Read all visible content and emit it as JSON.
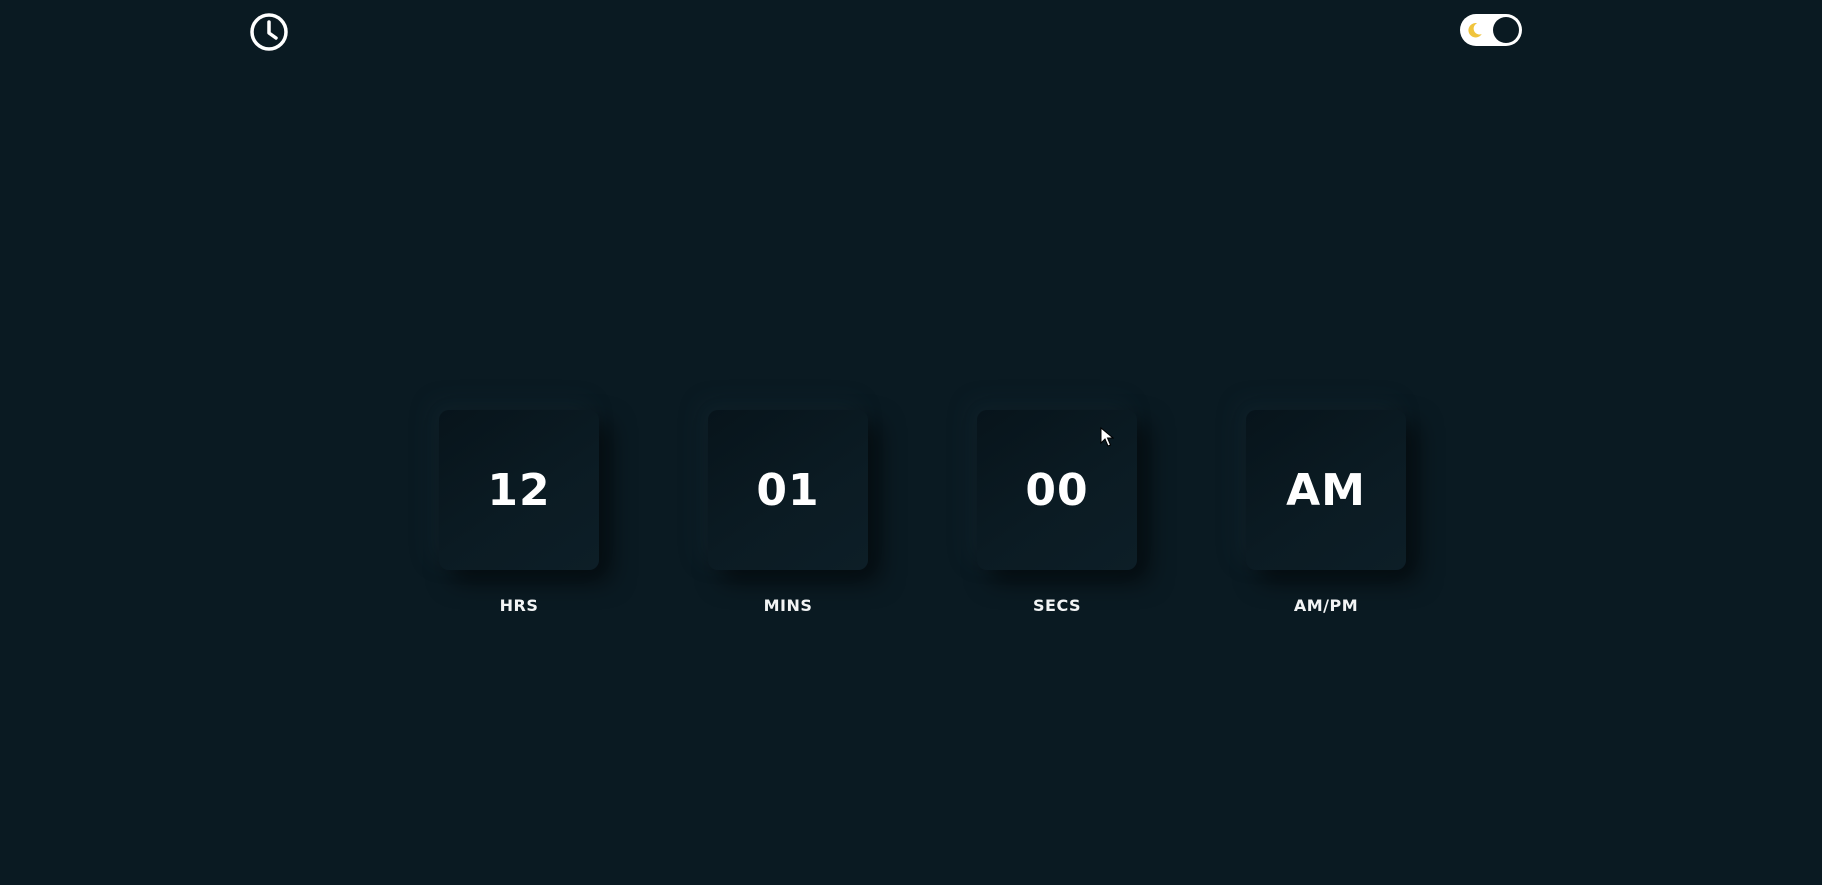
{
  "header": {
    "logo_icon": "clock-icon",
    "theme_toggle": {
      "icon": "moon-icon",
      "state": "dark",
      "moon_color": "#f0c43c"
    }
  },
  "clock": {
    "units": [
      {
        "value": "12",
        "label": "HRS"
      },
      {
        "value": "01",
        "label": "MINS"
      },
      {
        "value": "00",
        "label": "SECS"
      },
      {
        "value": "AM",
        "label": "AM/PM"
      }
    ]
  },
  "colors": {
    "background": "#0a1a22",
    "text": "#ffffff"
  }
}
